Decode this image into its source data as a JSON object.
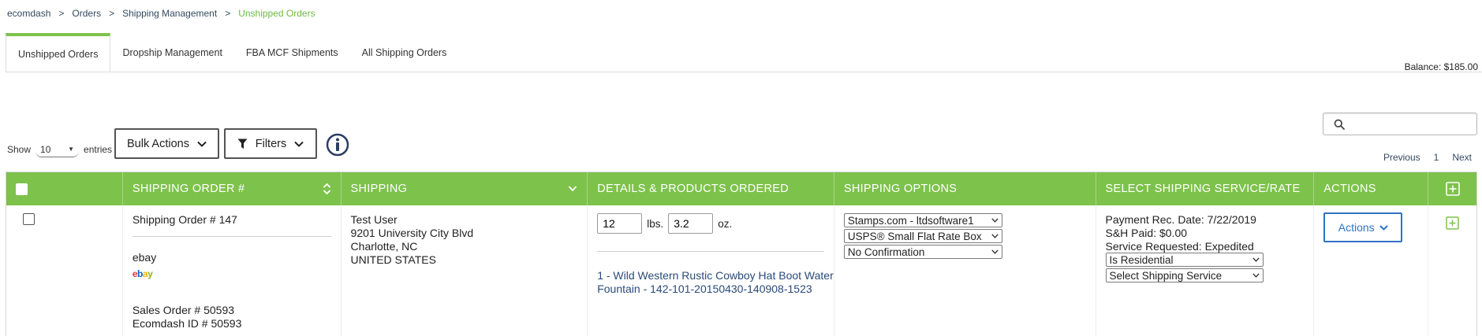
{
  "breadcrumb": {
    "items": [
      "ecomdash",
      "Orders",
      "Shipping Management"
    ],
    "current": "Unshipped Orders",
    "separator": ">"
  },
  "tabs": [
    {
      "label": "Unshipped Orders",
      "active": true
    },
    {
      "label": "Dropship Management",
      "active": false
    },
    {
      "label": "FBA MCF Shipments",
      "active": false
    },
    {
      "label": "All Shipping Orders",
      "active": false
    }
  ],
  "balance": "Balance: $185.00",
  "search": {
    "placeholder": ""
  },
  "show_entries": {
    "prefix": "Show",
    "value": "10",
    "suffix": "entries"
  },
  "toolbar": {
    "bulk_actions": "Bulk Actions",
    "filters": "Filters"
  },
  "pagination": {
    "previous": "Previous",
    "page": "1",
    "next": "Next"
  },
  "table": {
    "headers": [
      "SHIPPING ORDER #",
      "SHIPPING",
      "DETAILS & PRODUCTS ORDERED",
      "SHIPPING OPTIONS",
      "SELECT SHIPPING SERVICE/RATE",
      "ACTIONS"
    ],
    "rows": [
      {
        "order_number": "Shipping Order # 147",
        "channel": "ebay",
        "sales_order": "Sales Order # 50593",
        "ecomdash_id": "Ecomdash ID # 50593",
        "address": {
          "name": "Test User",
          "street": "9201 University City Blvd",
          "city": "Charlotte, NC",
          "country": "UNITED STATES"
        },
        "weight_lbs": "12",
        "lbs_label": "lbs.",
        "weight_oz": "3.2",
        "oz_label": "oz.",
        "product": "1 - Wild Western Rustic Cowboy Hat Boot Water Fountain - 142-101-20150430-140908-1523",
        "shipping_options": {
          "account": "Stamps.com - ltdsoftware1",
          "package": "USPS® Small Flat Rate Box",
          "confirmation": "No Confirmation"
        },
        "rate": {
          "payment_date": "Payment Rec. Date: 7/22/2019",
          "sh_paid": "S&H Paid: $0.00",
          "service_requested": "Service Requested: Expedited",
          "residential": "Is Residential",
          "service": "Select Shipping Service"
        },
        "actions_label": "Actions"
      }
    ]
  },
  "ebay_logo": {
    "letters": [
      "e",
      "b",
      "a",
      "y"
    ],
    "colors": [
      "#e53238",
      "#0064d2",
      "#f5af02",
      "#86b817"
    ]
  },
  "colors": {
    "header_green": "#7dc24b",
    "breadcrumb_current": "#6cbc3f",
    "actions_blue": "#2f73c4",
    "product_link": "#2a4a7a"
  }
}
